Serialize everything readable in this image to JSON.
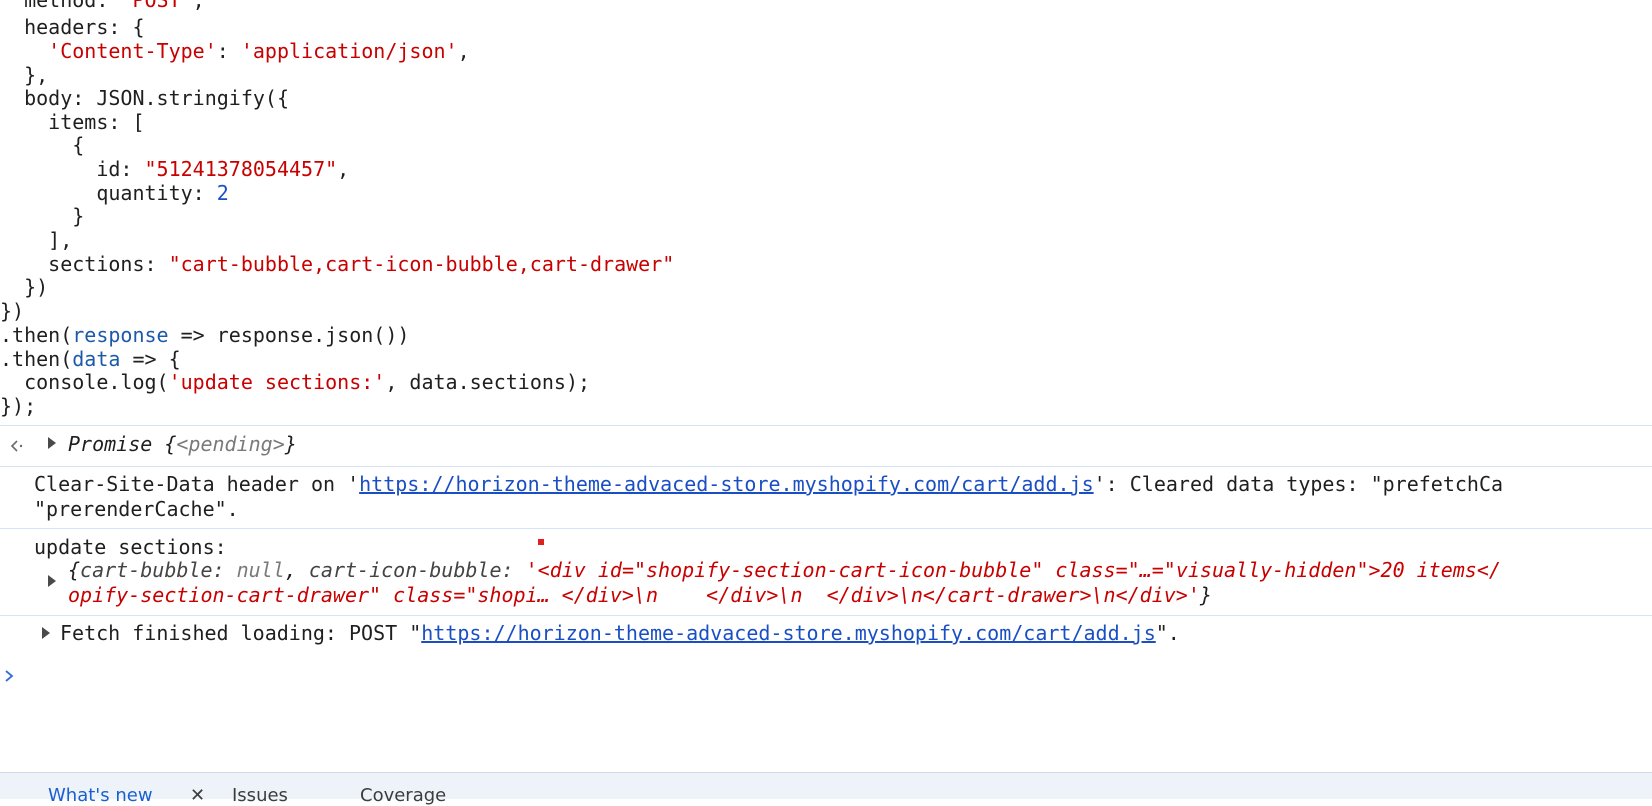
{
  "code": {
    "l1": {
      "a": "  method: ",
      "b": "'POST'",
      "c": ","
    },
    "l2": "  headers: {",
    "l3": {
      "a": "    ",
      "b": "'Content-Type'",
      "c": ": ",
      "d": "'application/json'",
      "e": ","
    },
    "l4": "  },",
    "l5": "  body: JSON.stringify({",
    "l6": "    items: [",
    "l7": "      {",
    "l8": {
      "a": "        id: ",
      "b": "\"51241378054457\"",
      "c": ","
    },
    "l9": {
      "a": "        quantity: ",
      "b": "2"
    },
    "l10": "      }",
    "l11": "    ],",
    "l12": {
      "a": "    sections: ",
      "b": "\"cart-bubble,cart-icon-bubble,cart-drawer\""
    },
    "l13": "  })",
    "l14": "})",
    "l15": {
      "a": ".then(",
      "b": "response",
      "c": " => response.json())"
    },
    "l16": {
      "a": ".then(",
      "b": "data",
      "c": " => {"
    },
    "l17": {
      "a": "  console.log(",
      "b": "'update sections:'",
      "c": ", data.sections);"
    },
    "l18": "});"
  },
  "return_value": {
    "arrow_icon": "return-arrow-icon",
    "prefix": "Promise {",
    "state": "<pending>",
    "suffix": "}"
  },
  "clear_site_data": {
    "line1_prefix": "Clear-Site-Data header on '",
    "url": "https://horizon-theme-advaced-store.myshopify.com/cart/add.js",
    "line1_suffix": "': Cleared data types: \"prefetchCa",
    "line2": "\"prerenderCache\"."
  },
  "update_sections": {
    "label": "update sections:",
    "obj_open": "{",
    "key1": "cart-bubble",
    "colon1": ": ",
    "val1": "null",
    "comma1": ", ",
    "key2": "cart-icon-bubble",
    "colon2": ": ",
    "val2_line1": "'<div id=\"shopify-section-cart-icon-bubble\" class=\"…=\"visually-hidden\">20 items</",
    "val2_line2": "opify-section-cart-drawer\" class=\"shopi… </div>\\n    </div>\\n  </div>\\n</cart-drawer>\\n</div>'",
    "obj_close": "}"
  },
  "fetch": {
    "prefix": "Fetch finished loading: POST \"",
    "url": "https://horizon-theme-advaced-store.myshopify.com/cart/add.js",
    "suffix": "\"."
  },
  "prompt_icon": "prompt-chevron-icon",
  "drawer_tabs": {
    "whats_new": "What's new",
    "issues": "Issues",
    "coverage": "Coverage"
  },
  "colors": {
    "string": "#c80000",
    "number": "#1a4fc4",
    "link": "#1a4fc4",
    "separator": "#d6e2f5"
  }
}
